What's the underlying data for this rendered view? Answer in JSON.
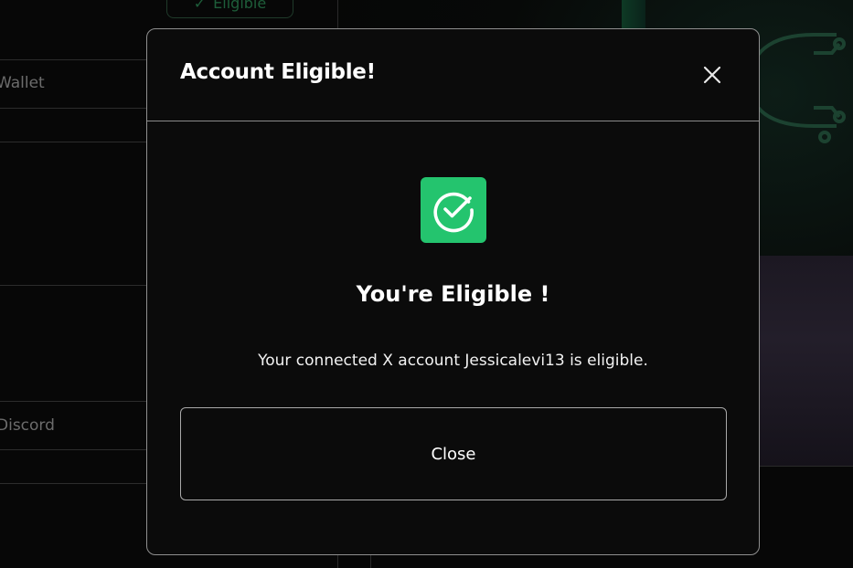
{
  "background": {
    "eligible_pill_label": "Eligible",
    "left_labels": [
      "Wallet",
      "Discord"
    ]
  },
  "modal": {
    "title": "Account Eligible!",
    "icon": "check-circle-icon",
    "headline": "You're Eligible !",
    "message": "Your connected X account Jessicalevi13 is eligible.",
    "close_button_label": "Close",
    "accent_color": "#24c46e"
  }
}
